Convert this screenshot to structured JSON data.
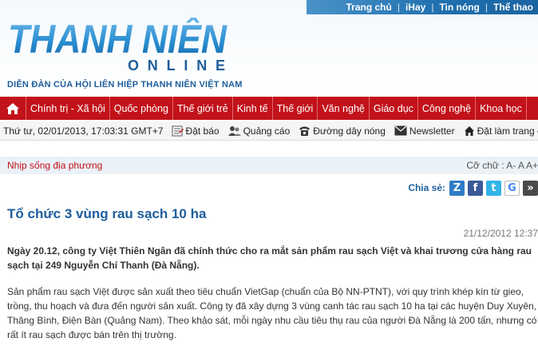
{
  "topbar": {
    "links": [
      "Trang chủ",
      "iHay",
      "Tin nóng",
      "Thể thao"
    ]
  },
  "logo": {
    "brand": "THANH NIÊN",
    "sub": "ONLINE",
    "tagline": "DIỄN ĐÀN CỦA HỘI LIÊN HIỆP THANH NIÊN VIỆT NAM"
  },
  "nav": {
    "home_icon": "home-icon",
    "items": [
      "Chính trị - Xã hội",
      "Quốc phòng",
      "Thế giới trẻ",
      "Kinh tế",
      "Thế giới",
      "Văn nghệ",
      "Giáo dục",
      "Công nghệ",
      "Khoa học"
    ]
  },
  "toolbar": {
    "date": "Thứ tư, 02/01/2013, 17:03:31 GMT+7",
    "subscribe": "Đặt báo",
    "ads": "Quảng cáo",
    "hotline": "Đường dây nóng",
    "newsletter": "Newsletter",
    "homepage": "Đặt làm trang chủ"
  },
  "section": {
    "breadcrumb": "Nhịp sống địa phương",
    "font_size": "Cỡ chữ : A- A A+"
  },
  "share": {
    "label": "Chia sẻ:",
    "buttons": [
      {
        "icon": "zing-icon",
        "glyph": "Z",
        "color": "#2e7dc6"
      },
      {
        "icon": "facebook-icon",
        "glyph": "f",
        "color": "#3b5998"
      },
      {
        "icon": "twitter-icon",
        "glyph": "t",
        "color": "#33b3e8"
      },
      {
        "icon": "google-icon",
        "glyph": "G",
        "color": "#ffffff"
      },
      {
        "icon": "more-icon",
        "glyph": "»",
        "color": "#4b4b4b"
      }
    ]
  },
  "article": {
    "title": "Tổ chức 3 vùng rau sạch 10 ha",
    "date": "21/12/2012 12:37",
    "lead": "Ngày 20.12, công ty Việt Thiên Ngân đã chính thức cho ra mắt sản phẩm rau sạch Việt và khai trương cửa hàng rau sạch tại 249 Nguyễn Chí Thanh (Đà Nẵng).",
    "body": "Sản phẩm rau sạch Việt được sản xuất theo tiêu chuẩn VietGap (chuẩn của Bộ NN-PTNT), với quy trình khép kín từ gieo, trồng, thu hoạch và đưa đến người sản xuất. Công ty đã xây dựng 3 vùng canh tác rau sạch 10 ha tại các huyện Duy Xuyên, Thăng Bình, Điện Bàn (Quảng Nam). Theo khảo sát, mỗi ngày nhu cầu tiêu thụ rau của người Đà Nẵng là 200 tấn, nhưng có rất ít rau sạch được bán trên thị trường."
  },
  "colors": {
    "nav_red": "#c2121a",
    "brand_blue": "#1d5e9c",
    "logo_blue": "#2a8fd1"
  }
}
